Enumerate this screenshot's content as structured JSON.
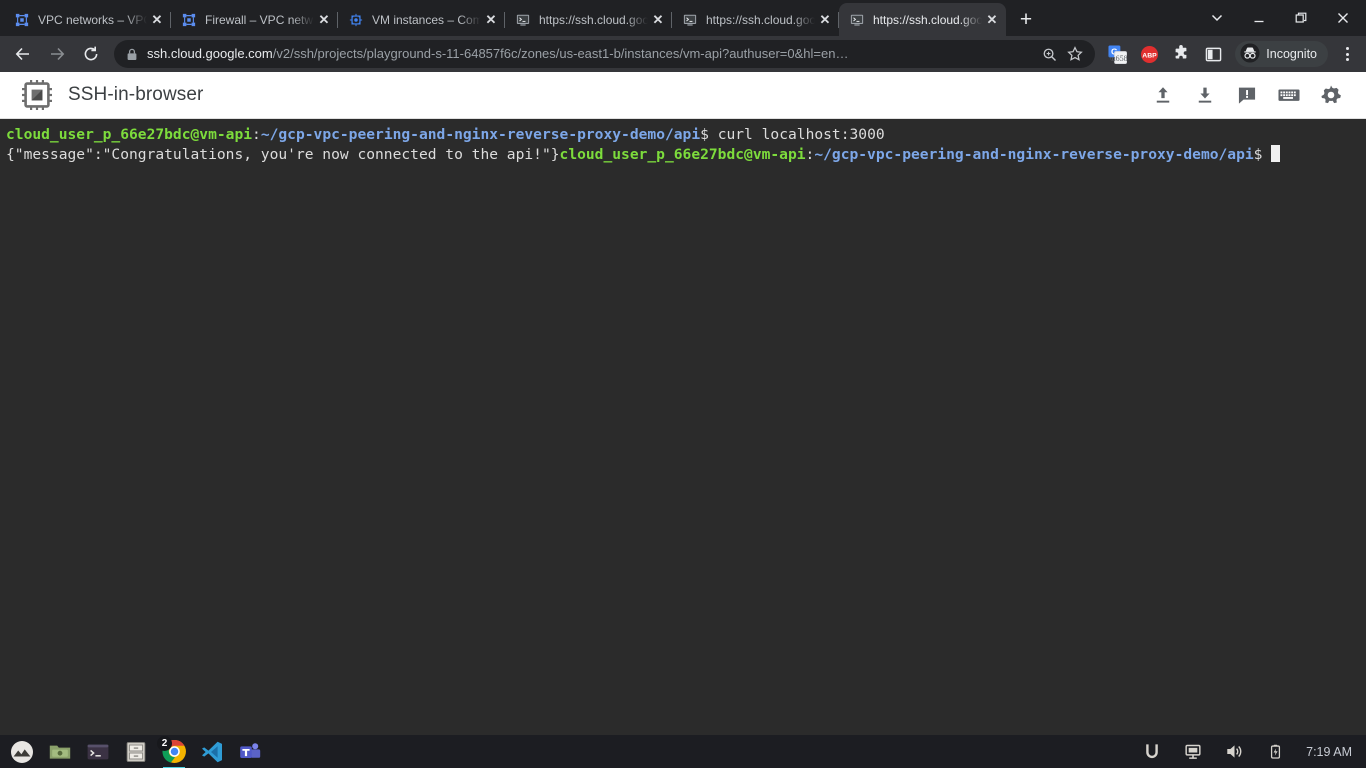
{
  "browser": {
    "tabs": [
      {
        "title": "VPC networks – VPC n",
        "favicon": "vpc-network-icon",
        "active": false
      },
      {
        "title": "Firewall – VPC networ",
        "favicon": "vpc-network-icon",
        "active": false
      },
      {
        "title": "VM instances – Comp",
        "favicon": "compute-engine-icon",
        "active": false
      },
      {
        "title": "https://ssh.cloud.goo",
        "favicon": "ssh-terminal-icon",
        "active": false
      },
      {
        "title": "https://ssh.cloud.goo",
        "favicon": "ssh-terminal-icon",
        "active": false
      },
      {
        "title": "https://ssh.cloud.goo",
        "favicon": "ssh-terminal-icon",
        "active": true
      }
    ],
    "new_tab_label": "+",
    "close_label": "✕",
    "window_controls": {
      "tab_search": "chevron-down",
      "minimize": "–",
      "maximize": "❐",
      "close": "✕"
    },
    "nav": {
      "back": "←",
      "forward": "→",
      "reload": "⟳"
    },
    "omnibox": {
      "url_domain": "ssh.cloud.google.com",
      "url_path": "/v2/ssh/projects/playground-s-11-64857f6c/zones/us-east1-b/instances/vm-api?authuser=0&hl=en…",
      "zoom_icon": "search-zoom-icon",
      "bookmark_icon": "star-icon"
    },
    "extensions": [
      {
        "name": "google-translate-icon",
        "label": "G"
      },
      {
        "name": "adblock-plus-icon",
        "label": "ABP"
      },
      {
        "name": "extensions-puzzle-icon",
        "label": ""
      },
      {
        "name": "side-panel-icon",
        "label": ""
      }
    ],
    "incognito_label": "Incognito",
    "menu_label": "⋮"
  },
  "ssh_app": {
    "title": "SSH-in-browser",
    "logo_icon": "cpu-chip-icon",
    "actions": [
      {
        "name": "upload-file-button",
        "icon": "upload-icon"
      },
      {
        "name": "download-file-button",
        "icon": "download-icon"
      },
      {
        "name": "send-feedback-button",
        "icon": "feedback-bubble-icon"
      },
      {
        "name": "on-screen-keyboard-button",
        "icon": "keyboard-icon"
      },
      {
        "name": "settings-button",
        "icon": "gear-icon"
      }
    ]
  },
  "terminal": {
    "prompt_user": "cloud_user_p_66e27bdc@vm-api",
    "prompt_sep": ":",
    "prompt_path": "~/gcp-vpc-peering-and-nginx-reverse-proxy-demo/api",
    "prompt_dollar": "$ ",
    "command": "curl localhost:3000",
    "response": "{\"message\":\"Congratulations, you're now connected to the api!\"}",
    "prompt2_user": "cloud_user_p_66e27bdc@vm-api",
    "prompt2_path": "~/gcp-vpc-peering-and-nginx-reverse-proxy-d",
    "prompt2_path_wrap": "emo/api",
    "prompt2_dollar": "$ ",
    "colors": {
      "background": "#2b2b2b",
      "prompt_green": "#7ddc3c",
      "path_blue": "#7da7e8",
      "text": "#dcdcdc",
      "cursor": "#f0f0f0"
    }
  },
  "taskbar": {
    "apps": [
      {
        "name": "app-menu-icon",
        "badge": ""
      },
      {
        "name": "file-manager-icon",
        "badge": ""
      },
      {
        "name": "terminal-icon",
        "badge": ""
      },
      {
        "name": "file-archiver-icon",
        "badge": ""
      },
      {
        "name": "google-chrome-icon",
        "badge": "2"
      },
      {
        "name": "vscode-icon",
        "badge": ""
      },
      {
        "name": "microsoft-teams-icon",
        "badge": ""
      }
    ],
    "tray": [
      {
        "name": "ubuntu-indicator-icon"
      },
      {
        "name": "display-icon"
      },
      {
        "name": "volume-icon"
      },
      {
        "name": "battery-charging-icon"
      }
    ],
    "clock": "7:19 AM"
  }
}
